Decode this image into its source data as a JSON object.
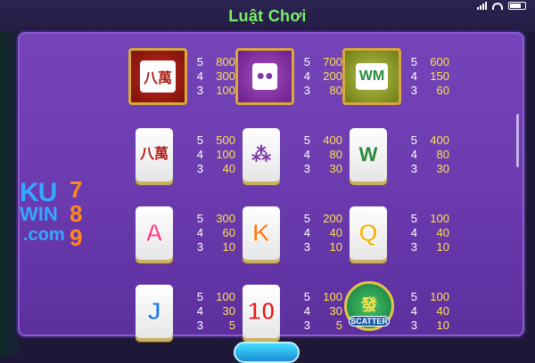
{
  "title": "Luật Chơi",
  "logo": {
    "ku": "KU",
    "win": "WIN",
    "com": ".com",
    "d7": "7",
    "d8": "8",
    "d9": "9"
  },
  "bottom_button": "",
  "symbols": [
    {
      "name": "red-dragon-stack",
      "glyph": "八萬",
      "style": "red",
      "pays": [
        [
          "5",
          "800"
        ],
        [
          "4",
          "300"
        ],
        [
          "3",
          "100"
        ]
      ]
    },
    {
      "name": "purple-dots-stack",
      "glyph": "●●",
      "style": "purple",
      "pays": [
        [
          "5",
          "700"
        ],
        [
          "4",
          "200"
        ],
        [
          "3",
          "80"
        ]
      ]
    },
    {
      "name": "green-bamboo-stack",
      "glyph": "WM",
      "style": "green",
      "pays": [
        [
          "5",
          "600"
        ],
        [
          "4",
          "150"
        ],
        [
          "3",
          "60"
        ]
      ]
    },
    {
      "name": "eight-wan-tile",
      "glyph": "八萬",
      "style": "tile",
      "pays": [
        [
          "5",
          "500"
        ],
        [
          "4",
          "100"
        ],
        [
          "3",
          "40"
        ]
      ]
    },
    {
      "name": "circles-tile",
      "glyph": "⁂",
      "style": "tile",
      "pays": [
        [
          "5",
          "400"
        ],
        [
          "4",
          "80"
        ],
        [
          "3",
          "30"
        ]
      ]
    },
    {
      "name": "bamboo-tile",
      "glyph": "W",
      "style": "tile",
      "pays": [
        [
          "5",
          "400"
        ],
        [
          "4",
          "80"
        ],
        [
          "3",
          "30"
        ]
      ]
    },
    {
      "name": "ace-tile",
      "glyph": "A",
      "style": "tile",
      "color": "#ff3d86",
      "pays": [
        [
          "5",
          "300"
        ],
        [
          "4",
          "60"
        ],
        [
          "3",
          "10"
        ]
      ]
    },
    {
      "name": "king-tile",
      "glyph": "K",
      "style": "tile",
      "color": "#ff7a16",
      "pays": [
        [
          "5",
          "200"
        ],
        [
          "4",
          "40"
        ],
        [
          "3",
          "10"
        ]
      ]
    },
    {
      "name": "queen-tile",
      "glyph": "Q",
      "style": "tile",
      "color": "#f4b116",
      "pays": [
        [
          "5",
          "100"
        ],
        [
          "4",
          "40"
        ],
        [
          "3",
          "10"
        ]
      ]
    },
    {
      "name": "jack-tile",
      "glyph": "J",
      "style": "tile",
      "color": "#1e78e8",
      "pays": [
        [
          "5",
          "100"
        ],
        [
          "4",
          "30"
        ],
        [
          "3",
          "5"
        ]
      ]
    },
    {
      "name": "ten-tile",
      "glyph": "10",
      "style": "tile",
      "color": "#e21e1e",
      "pays": [
        [
          "5",
          "100"
        ],
        [
          "4",
          "30"
        ],
        [
          "3",
          "5"
        ]
      ]
    },
    {
      "name": "scatter-symbol",
      "glyph": "發",
      "style": "scatter",
      "label": "SCATTER",
      "pays": [
        [
          "5",
          "100"
        ],
        [
          "4",
          "40"
        ],
        [
          "3",
          "10"
        ]
      ]
    }
  ]
}
